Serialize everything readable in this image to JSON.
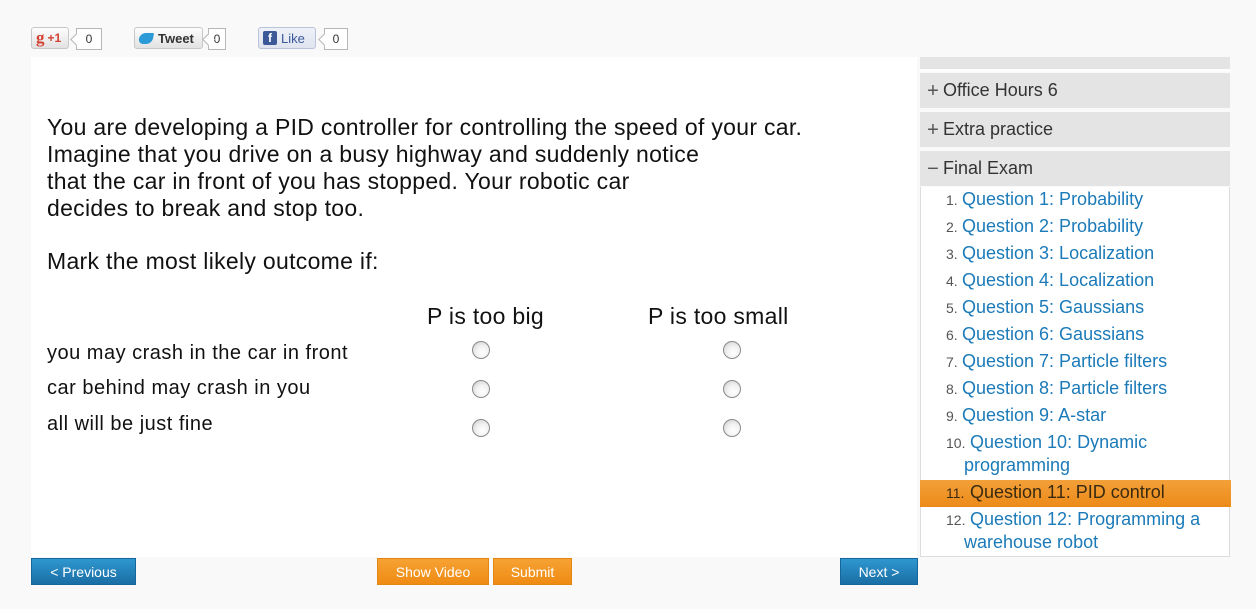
{
  "social": {
    "gplus": {
      "icon": "google-plus-icon",
      "letter": "g",
      "label": "+1",
      "count": "0"
    },
    "tweet": {
      "icon": "twitter-bird-icon",
      "label": "Tweet",
      "count": "0"
    },
    "facebook": {
      "icon": "facebook-icon",
      "letter": "f",
      "label": "Like",
      "count": "0"
    }
  },
  "question": {
    "lines": [
      "You are developing a PID controller for controlling the speed of your car.",
      "Imagine that you drive on a busy highway and suddenly notice",
      "that the car in front of you has stopped. Your robotic car",
      "decides to break and stop too."
    ],
    "prompt": "Mark the most likely outcome if:",
    "columns": [
      "P is too big",
      "P is too small"
    ],
    "rows": [
      "you may crash in the car in front",
      "car behind may crash in you",
      "all will be just fine"
    ]
  },
  "buttons": {
    "previous": "< Previous",
    "show_video": "Show Video",
    "submit": "Submit",
    "next": "Next >"
  },
  "sidebar": {
    "sections": [
      {
        "toggle": "+",
        "label": "Office Hours 6"
      },
      {
        "toggle": "+",
        "label": "Extra practice"
      },
      {
        "toggle": "−",
        "label": "Final Exam"
      }
    ],
    "questions": [
      {
        "num": "1.",
        "label": "Question 1: Probability"
      },
      {
        "num": "2.",
        "label": "Question 2: Probability"
      },
      {
        "num": "3.",
        "label": "Question 3: Localization"
      },
      {
        "num": "4.",
        "label": "Question 4: Localization"
      },
      {
        "num": "5.",
        "label": "Question 5: Gaussians"
      },
      {
        "num": "6.",
        "label": "Question 6: Gaussians"
      },
      {
        "num": "7.",
        "label": "Question 7: Particle filters"
      },
      {
        "num": "8.",
        "label": "Question 8: Particle filters"
      },
      {
        "num": "9.",
        "label": "Question 9: A-star"
      },
      {
        "num": "10.",
        "label_line1": "Question 10: Dynamic",
        "label_line2": "programming"
      },
      {
        "num": "11.",
        "label": "Question 11: PID control",
        "active": true
      },
      {
        "num": "12.",
        "label_line1": "Question 12: Programming a",
        "label_line2": "warehouse robot"
      }
    ]
  },
  "colors": {
    "accent_orange": "#ef8b14",
    "link_blue": "#1b7ab8",
    "button_blue": "#1a6ea5"
  }
}
